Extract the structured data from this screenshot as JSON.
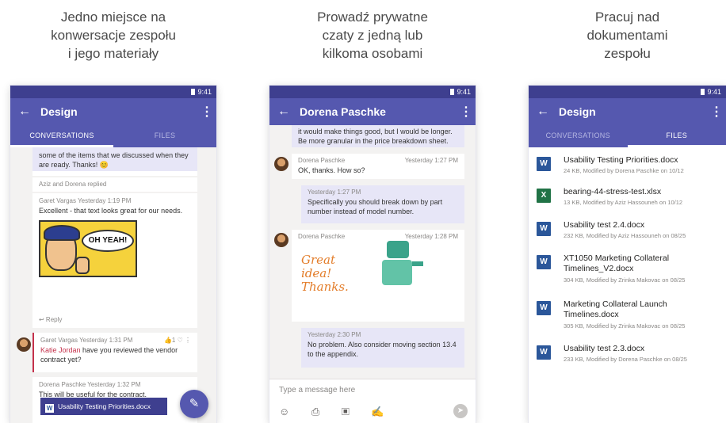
{
  "captions": [
    {
      "lines": [
        "Jedno miejsce na",
        "konwersacje zespołu",
        "i jego materiały"
      ]
    },
    {
      "lines": [
        "Prowadź prywatne",
        "czaty z jedną lub",
        "kilkoma osobami"
      ]
    },
    {
      "lines": [
        "Pracuj nad",
        "dokumentami",
        "zespołu"
      ]
    }
  ],
  "status_time": "9:41",
  "phone1": {
    "title": "Design",
    "tab_conversations": "CONVERSATIONS",
    "tab_files": "FILES",
    "msg1_text": "some of the items that we discussed when they are ready. Thanks! 😊",
    "replied": "Aziz and Dorena replied",
    "msg2_meta": "Garet Vargas   Yesterday 1:19 PM",
    "msg2_text": "Excellent - that text looks great for our needs.",
    "comic_text": "OH YEAH!",
    "reply_label": "↩ Reply",
    "msg3_meta": "Garet Vargas   Yesterday 1:31 PM",
    "msg3_mention": "Katie Jordan",
    "msg3_text": " have you reviewed the vendor contract yet?",
    "msg3_reactions": "👍1 ♡ ⋮",
    "msg4_meta": "Dorena Paschke   Yesterday 1:32 PM",
    "msg4_text": "This will be useful for the contract.",
    "file_chip": "Usability Testing Priorities.docx",
    "fab_icon": "✎"
  },
  "phone2": {
    "title": "Dorena Paschke",
    "top_text": "it would make things good, but I would be longer. Be more granular in the price breakdown sheet.",
    "m1_sender": "Dorena Paschke",
    "m1_time": "Yesterday 1:27 PM",
    "m1_text": "OK, thanks. How so?",
    "m2_time": "Yesterday 1:27 PM",
    "m2_text": "Specifically you should break down by part number instead of model number.",
    "m3_sender": "Dorena Paschke",
    "m3_time": "Yesterday 1:28 PM",
    "sticker_lines": [
      "Great",
      "idea!",
      "Thanks."
    ],
    "m4_time": "Yesterday 2:30 PM",
    "m4_text": "No problem. Also consider moving section 13.4 to the appendix.",
    "composer_placeholder": "Type a message here",
    "composer_icons": "☺ ⎙ ▣ ✍",
    "send_icon": "➤"
  },
  "phone3": {
    "title": "Design",
    "tab_conversations": "CONVERSATIONS",
    "tab_files": "FILES",
    "files": [
      {
        "name": "Usability Testing Priorities.docx",
        "meta": "24 KB, Modified by Dorena Paschke on 10/12",
        "type": "W"
      },
      {
        "name": "bearing-44-stress-test.xlsx",
        "meta": "13 KB, Modified by Aziz Hassouneh on 10/12",
        "type": "X"
      },
      {
        "name": "Usability test 2.4.docx",
        "meta": "232 KB, Modified by Aziz Hassouneh on 08/25",
        "type": "W"
      },
      {
        "name": "XT1050 Marketing Collateral Timelines_V2.docx",
        "meta": "304 KB, Modified by Zrinka Makovac on 08/25",
        "type": "W"
      },
      {
        "name": "Marketing Collateral Launch Timelines.docx",
        "meta": "305 KB, Modified by Zrinka Makovac on 08/25",
        "type": "W"
      },
      {
        "name": "Usability test 2.3.docx",
        "meta": "233 KB, Modified by Dorena Paschke on 08/25",
        "type": "W"
      }
    ]
  }
}
